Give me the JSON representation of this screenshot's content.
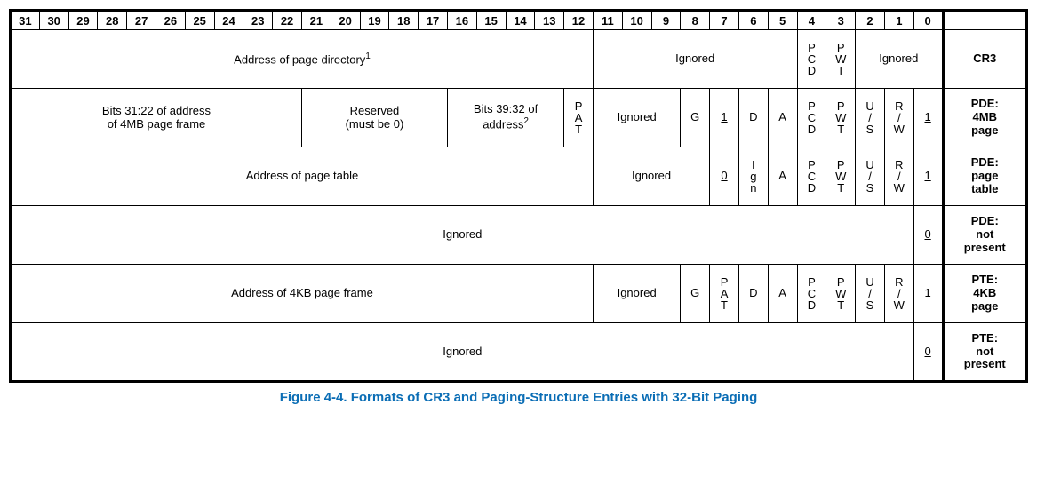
{
  "bits": [
    "31",
    "30",
    "29",
    "28",
    "27",
    "26",
    "25",
    "24",
    "23",
    "22",
    "21",
    "20",
    "19",
    "18",
    "17",
    "16",
    "15",
    "14",
    "13",
    "12",
    "11",
    "10",
    "9",
    "8",
    "7",
    "6",
    "5",
    "4",
    "3",
    "2",
    "1",
    "0"
  ],
  "caption": "Figure 4-4.  Formats of CR3 and Paging-Structure Entries with 32-Bit Paging",
  "rows": {
    "cr3": {
      "label": "CR3",
      "f0": "Address of page directory",
      "sup0": "1",
      "f1": "Ignored",
      "pcd": "PCD",
      "pwt": "PWT",
      "ign2": "Ignored"
    },
    "pde4mb": {
      "label_l1": "PDE:",
      "label_l2": "4MB",
      "label_l3": "page",
      "f0_l1": "Bits 31:22 of address",
      "f0_l2": "of 4MB page frame",
      "f1_l1": "Reserved",
      "f1_l2": "(must be 0)",
      "f2": "Bits 39:32 of address",
      "sup2": "2",
      "pat": "PAT",
      "ign": "Ignored",
      "g": "G",
      "one": "1",
      "d": "D",
      "a": "A",
      "pcd": "PCD",
      "pwt": "PWT",
      "us": "U/S",
      "rw": "R/W",
      "p": "1"
    },
    "pdetable": {
      "label_l1": "PDE:",
      "label_l2": "page",
      "label_l3": "table",
      "f0": "Address of page table",
      "ign": "Ignored",
      "zero": "0",
      "ig": "Ign",
      "a": "A",
      "pcd": "PCD",
      "pwt": "PWT",
      "us": "U/S",
      "rw": "R/W",
      "p": "1"
    },
    "pdenp": {
      "label_l1": "PDE:",
      "label_l2": "not",
      "label_l3": "present",
      "ign": "Ignored",
      "p": "0"
    },
    "pte4kb": {
      "label_l1": "PTE:",
      "label_l2": "4KB",
      "label_l3": "page",
      "f0": "Address of 4KB page frame",
      "ign": "Ignored",
      "g": "G",
      "pat": "PAT",
      "d": "D",
      "a": "A",
      "pcd": "PCD",
      "pwt": "PWT",
      "us": "U/S",
      "rw": "R/W",
      "p": "1"
    },
    "ptenp": {
      "label_l1": "PTE:",
      "label_l2": "not",
      "label_l3": "present",
      "ign": "Ignored",
      "p": "0"
    }
  },
  "chart_data": {
    "type": "table",
    "title": "Formats of CR3 and Paging-Structure Entries with 32-Bit Paging",
    "bit_range": [
      31,
      0
    ],
    "entries": [
      {
        "name": "CR3",
        "fields": [
          {
            "bits": "31:12",
            "meaning": "Address of page directory",
            "footnote": 1
          },
          {
            "bits": "11:5",
            "meaning": "Ignored"
          },
          {
            "bits": "4",
            "meaning": "PCD"
          },
          {
            "bits": "3",
            "meaning": "PWT"
          },
          {
            "bits": "2:0",
            "meaning": "Ignored"
          }
        ]
      },
      {
        "name": "PDE: 4MB page",
        "fields": [
          {
            "bits": "31:22",
            "meaning": "Bits 31:22 of address of 4MB page frame"
          },
          {
            "bits": "21:17",
            "meaning": "Reserved (must be 0)"
          },
          {
            "bits": "16:13",
            "meaning": "Bits 39:32 of address",
            "footnote": 2
          },
          {
            "bits": "12",
            "meaning": "PAT"
          },
          {
            "bits": "11:9",
            "meaning": "Ignored"
          },
          {
            "bits": "8",
            "meaning": "G"
          },
          {
            "bits": "7",
            "meaning": "1 (PS)"
          },
          {
            "bits": "6",
            "meaning": "D"
          },
          {
            "bits": "5",
            "meaning": "A"
          },
          {
            "bits": "4",
            "meaning": "PCD"
          },
          {
            "bits": "3",
            "meaning": "PWT"
          },
          {
            "bits": "2",
            "meaning": "U/S"
          },
          {
            "bits": "1",
            "meaning": "R/W"
          },
          {
            "bits": "0",
            "meaning": "1 (Present)"
          }
        ]
      },
      {
        "name": "PDE: page table",
        "fields": [
          {
            "bits": "31:12",
            "meaning": "Address of page table"
          },
          {
            "bits": "11:8",
            "meaning": "Ignored"
          },
          {
            "bits": "7",
            "meaning": "0 (PS)"
          },
          {
            "bits": "6",
            "meaning": "Ign"
          },
          {
            "bits": "5",
            "meaning": "A"
          },
          {
            "bits": "4",
            "meaning": "PCD"
          },
          {
            "bits": "3",
            "meaning": "PWT"
          },
          {
            "bits": "2",
            "meaning": "U/S"
          },
          {
            "bits": "1",
            "meaning": "R/W"
          },
          {
            "bits": "0",
            "meaning": "1 (Present)"
          }
        ]
      },
      {
        "name": "PDE: not present",
        "fields": [
          {
            "bits": "31:1",
            "meaning": "Ignored"
          },
          {
            "bits": "0",
            "meaning": "0 (Present)"
          }
        ]
      },
      {
        "name": "PTE: 4KB page",
        "fields": [
          {
            "bits": "31:12",
            "meaning": "Address of 4KB page frame"
          },
          {
            "bits": "11:9",
            "meaning": "Ignored"
          },
          {
            "bits": "8",
            "meaning": "G"
          },
          {
            "bits": "7",
            "meaning": "PAT"
          },
          {
            "bits": "6",
            "meaning": "D"
          },
          {
            "bits": "5",
            "meaning": "A"
          },
          {
            "bits": "4",
            "meaning": "PCD"
          },
          {
            "bits": "3",
            "meaning": "PWT"
          },
          {
            "bits": "2",
            "meaning": "U/S"
          },
          {
            "bits": "1",
            "meaning": "R/W"
          },
          {
            "bits": "0",
            "meaning": "1 (Present)"
          }
        ]
      },
      {
        "name": "PTE: not present",
        "fields": [
          {
            "bits": "31:1",
            "meaning": "Ignored"
          },
          {
            "bits": "0",
            "meaning": "0 (Present)"
          }
        ]
      }
    ]
  }
}
